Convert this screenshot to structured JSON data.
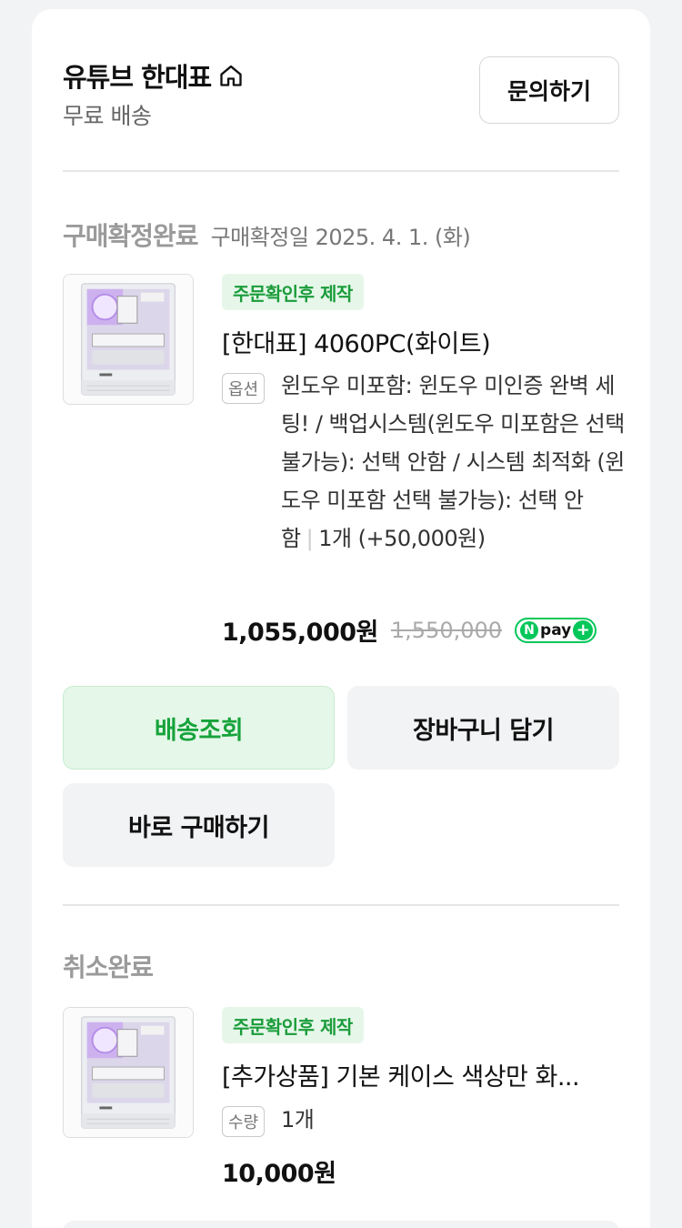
{
  "store": {
    "name": "유튜브 한대표",
    "shipping": "무료 배송",
    "inquiry_label": "문의하기"
  },
  "order1": {
    "status": "구매확정완료",
    "date": "구매확정일 2025. 4. 1. (화)",
    "badge": "주문확인후 제작",
    "product_name": "[한대표] 4060PC(화이트)",
    "option_tag": "옵션",
    "option_text": "윈도우 미포함: 윈도우 미인증 완벽 세팅! / 백업시스템(윈도우 미포함은 선택 불가능): 선택 안함 / 시스템 최적화 (윈도우 미포함 선택 불가능): 선택 안함",
    "quantity_text": "1개 (+50,000원)",
    "price": "1,055,000원",
    "original_price": "1,550,000",
    "npay": {
      "n": "N",
      "pay": "pay",
      "plus": "+"
    }
  },
  "actions": {
    "track_delivery": "배송조회",
    "add_to_cart": "장바구니 담기",
    "buy_now": "바로 구매하기"
  },
  "order2": {
    "status": "취소완료",
    "badge": "주문확인후 제작",
    "product_name": "[추가상품] 기본 케이스 색상만 화...",
    "quantity_tag": "수량",
    "quantity": "1개",
    "price": "10,000원"
  },
  "colors": {
    "accent_green": "#17a33b",
    "badge_bg": "#e6f7ea",
    "npay_green": "#03c75a"
  }
}
